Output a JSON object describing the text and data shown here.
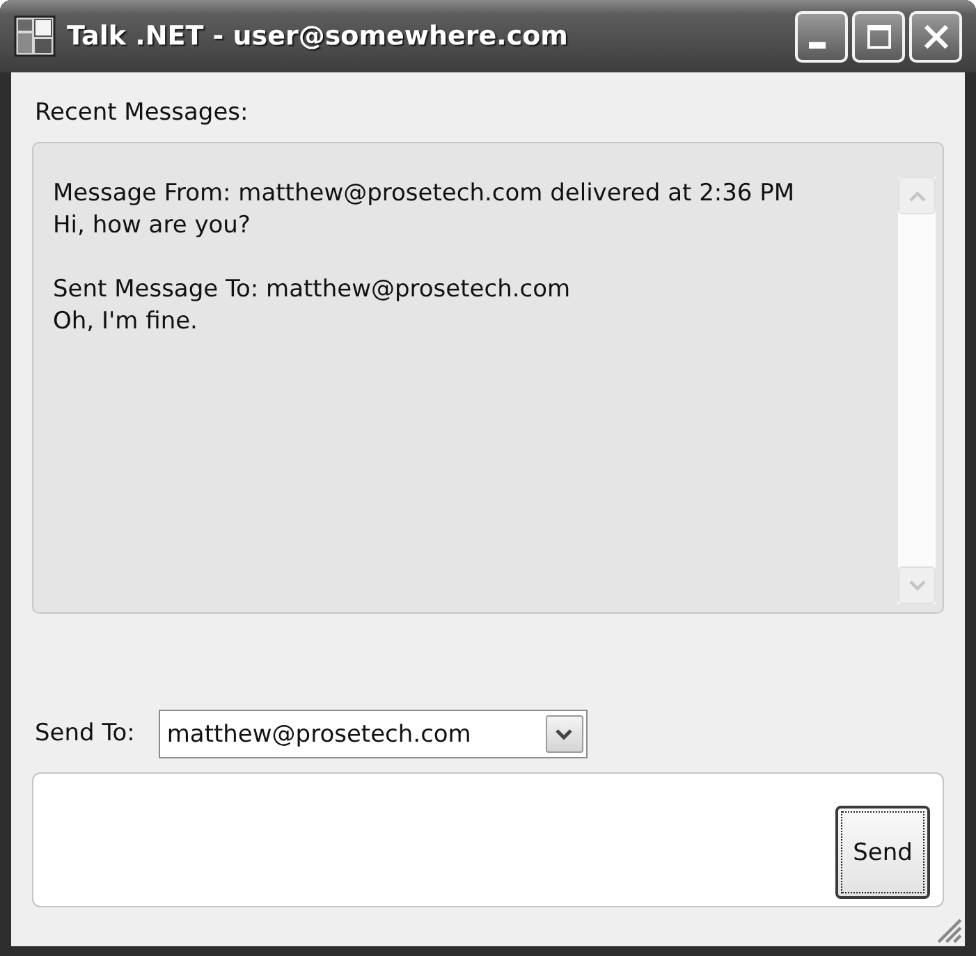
{
  "window": {
    "title": "Talk .NET - user@somewhere.com"
  },
  "recent_messages": {
    "label": "Recent Messages:",
    "messages": [
      {
        "header": "Message From: matthew@prosetech.com delivered at 2:36 PM",
        "body": "Hi, how are you?"
      },
      {
        "header": "Sent Message To: matthew@prosetech.com",
        "body": "Oh, I'm fine."
      }
    ]
  },
  "send_to": {
    "label": "Send To:",
    "value": "matthew@prosetech.com"
  },
  "send_button": {
    "label": "Send",
    "focused": true
  }
}
